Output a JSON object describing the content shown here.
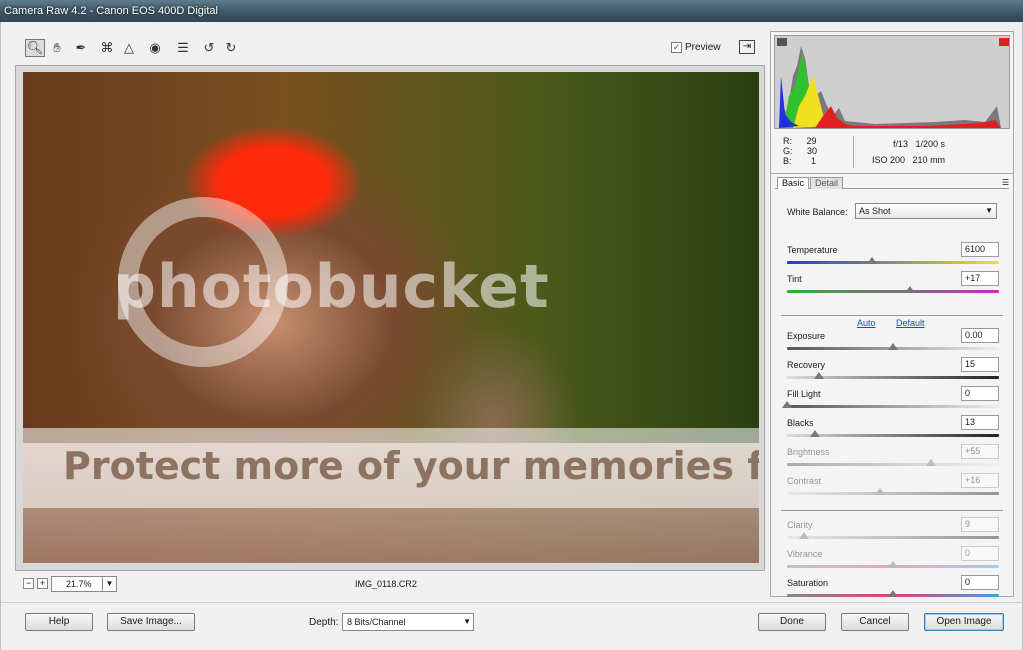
{
  "window": {
    "title": "Camera Raw 4.2  -  Canon EOS 400D Digital"
  },
  "toolbar": {
    "tools": [
      "zoom-icon",
      "hand-icon",
      "white-balance-icon",
      "crop-icon",
      "straighten-icon",
      "red-eye-icon",
      "preferences-icon",
      "rotate-left-icon",
      "rotate-right-icon"
    ],
    "preview_label": "Preview",
    "preview_checked": true
  },
  "watermark": {
    "logo": "photobucket",
    "tagline": "Protect more of your memories for less!"
  },
  "zoom": {
    "value": "21.7%",
    "minus": "−",
    "plus": "+"
  },
  "filename": "IMG_0118.CR2",
  "readout": {
    "r_label": "R:",
    "r": "29",
    "g_label": "G:",
    "g": "30",
    "b_label": "B:",
    "b": "1",
    "aperture": "f/13",
    "shutter": "1/200 s",
    "iso": "ISO 200",
    "focal": "210 mm"
  },
  "tabs": {
    "basic": "Basic",
    "detail": "Detail"
  },
  "basic": {
    "white_balance_label": "White Balance:",
    "white_balance_value": "As Shot",
    "auto_link": "Auto",
    "default_link": "Default",
    "sliders": [
      {
        "label": "Temperature",
        "value": "6100",
        "pos": 0.4
      },
      {
        "label": "Tint",
        "value": "+17",
        "pos": 0.58
      },
      {
        "label": "Exposure",
        "value": "0.00",
        "pos": 0.5
      },
      {
        "label": "Recovery",
        "value": "15",
        "pos": 0.15
      },
      {
        "label": "Fill Light",
        "value": "0",
        "pos": 0.0
      },
      {
        "label": "Blacks",
        "value": "13",
        "pos": 0.13
      },
      {
        "label": "Brightness",
        "value": "+55",
        "pos": 0.68
      },
      {
        "label": "Contrast",
        "value": "+16",
        "pos": 0.44
      },
      {
        "label": "Clarity",
        "value": "9",
        "pos": 0.08
      },
      {
        "label": "Vibrance",
        "value": "0",
        "pos": 0.5
      },
      {
        "label": "Saturation",
        "value": "0",
        "pos": 0.5
      }
    ]
  },
  "bottom": {
    "help": "Help",
    "save_image": "Save Image...",
    "depth_label": "Depth:",
    "depth_value": "8 Bits/Channel",
    "done": "Done",
    "cancel": "Cancel",
    "open_image": "Open Image"
  },
  "colors": {
    "accent": "#3c7fb1",
    "highlight_clip": "#ff2a0a"
  }
}
